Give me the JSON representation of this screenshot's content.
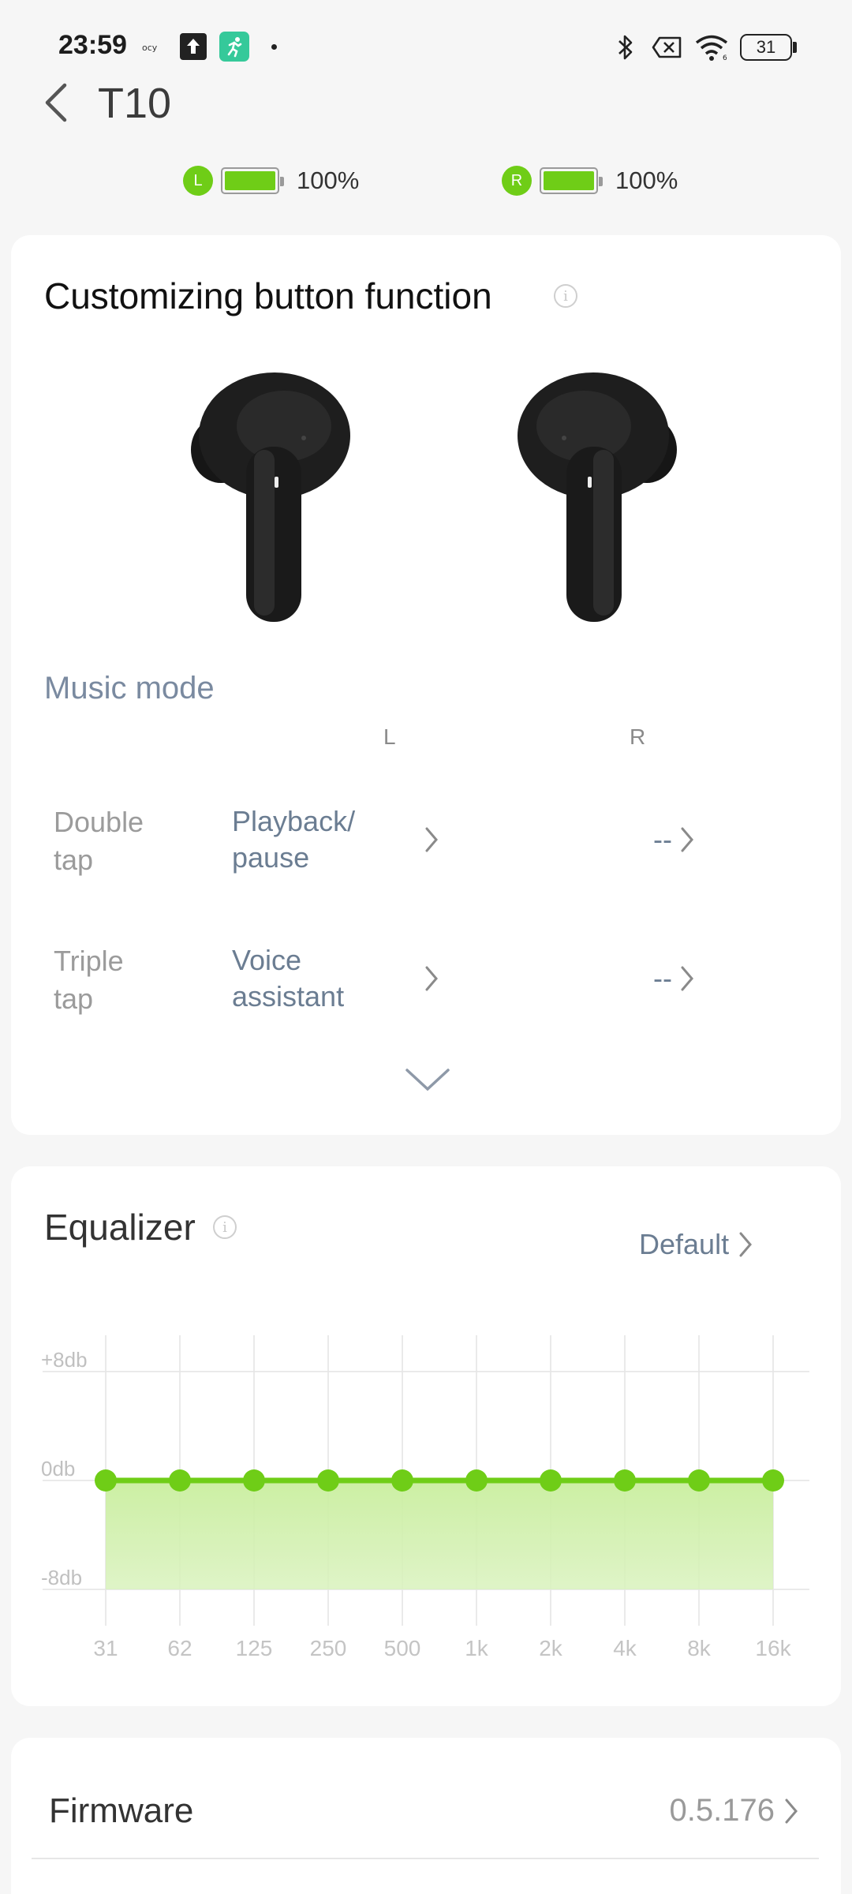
{
  "status_bar": {
    "time": "23:59",
    "icons_left": [
      "network-label-icon",
      "upload-icon",
      "fitness-app-icon",
      "dot-icon"
    ],
    "icons_right": [
      "bluetooth-icon",
      "no-sim-icon",
      "wifi-icon",
      "battery-icon"
    ],
    "battery_level": "31"
  },
  "header": {
    "title": "T10"
  },
  "battery": {
    "left": {
      "badge": "L",
      "level": 1.0,
      "text": "100%"
    },
    "right": {
      "badge": "R",
      "level": 1.0,
      "text": "100%"
    }
  },
  "button_card": {
    "title": "Customizing button function",
    "mode_label": "Music mode",
    "col_left": "L",
    "col_right": "R",
    "rows": [
      {
        "label_line1": "Double",
        "label_line2": "tap",
        "left_line1": "Playback/",
        "left_line2": "pause",
        "right": "--"
      },
      {
        "label_line1": "Triple",
        "label_line2": "tap",
        "left_line1": "Voice",
        "left_line2": "assistant",
        "right": "--"
      }
    ]
  },
  "equalizer": {
    "title": "Equalizer",
    "preset": "Default"
  },
  "chart_data": {
    "type": "line",
    "x": [
      "31",
      "62",
      "125",
      "250",
      "500",
      "1k",
      "2k",
      "4k",
      "8k",
      "16k"
    ],
    "series": [
      {
        "values": [
          0,
          0,
          0,
          0,
          0,
          0,
          0,
          0,
          0,
          0
        ]
      }
    ],
    "y_tick_labels": [
      "+8db",
      "0db",
      "-8db"
    ],
    "ylim": [
      -8,
      8
    ],
    "line_color": "#6fcd17"
  },
  "firmware": {
    "label": "Firmware",
    "version": "0.5.176"
  },
  "colors": {
    "accent": "#6fcd17",
    "value_text": "#6b7d92"
  }
}
